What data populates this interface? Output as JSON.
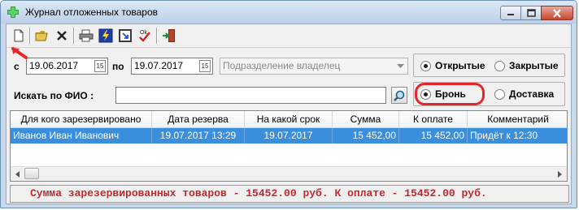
{
  "window": {
    "title": "Журнал отложенных товаров"
  },
  "toolbar": {
    "buttons": [
      "new-document",
      "open-folder",
      "delete",
      "print",
      "lightning",
      "export",
      "ok-check",
      "exit"
    ]
  },
  "filters": {
    "from_label": "с",
    "from_date": "19.06.2017",
    "to_label": "по",
    "to_date": "19.07.2017",
    "calendar_glyph": "15",
    "division_placeholder": "Подразделение владелец",
    "search_label": "Искать по ФИО :",
    "search_value": ""
  },
  "status_group": {
    "open_label": "Открытые",
    "closed_label": "Закрытые",
    "selected": "open"
  },
  "type_group": {
    "reserve_label": "Бронь",
    "delivery_label": "Доставка",
    "selected": "reserve"
  },
  "table": {
    "columns": [
      "Для кого зарезервировано",
      "Дата резерва",
      "На какой срок",
      "Сумма",
      "К оплате",
      "Комментарий"
    ],
    "rows": [
      {
        "customer": "Иванов Иван Иванович",
        "reserve_date": "19.07.2017 13:29",
        "term": "19.07.2017",
        "sum": "15 452,00",
        "to_pay": "15 452,00",
        "comment": "Придёт к 12:30"
      }
    ]
  },
  "summary": "Сумма зарезервированных товаров - 15452.00 руб. К оплате - 15452.00 руб.",
  "colors": {
    "accent_highlight": "#e4262b",
    "selected_row": "#3a8edb",
    "summary_text": "#c0292b"
  }
}
